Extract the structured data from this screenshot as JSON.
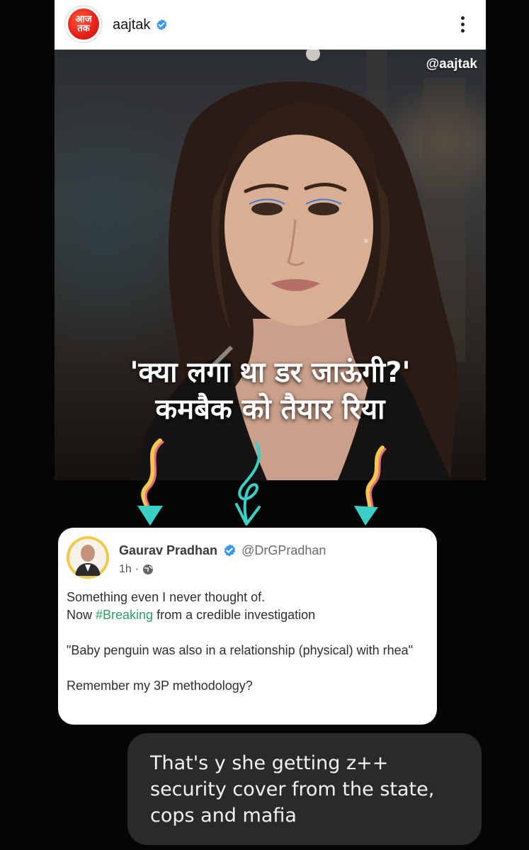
{
  "post": {
    "logo_text": "आज\nतक",
    "handle": "aajtak",
    "watermark": "@aajtak",
    "headline_line1": "'क्या लगा था डर जाऊंगी?'",
    "headline_line2": "कमबैक को तैयार रिया"
  },
  "tweet": {
    "name": "Gaurav Pradhan",
    "handle": "@DrGPradhan",
    "time": "1h",
    "line1": "Something even I never thought of.",
    "line2_prefix": "Now ",
    "hashtag": "#Breaking",
    "line2_suffix": " from a credible investigation",
    "quote": "\"Baby penguin was also in a relationship (physical) with rhea\"",
    "closing": "Remember my 3P methodology?"
  },
  "reply": {
    "text": "That's y she getting z++ security cover from the state, cops and mafia"
  },
  "colors": {
    "verified_blue": "#3897f0",
    "brand_red": "#e8231b",
    "hashtag_green": "#2f9e66",
    "arrow_teal": "#3ad0c8"
  }
}
